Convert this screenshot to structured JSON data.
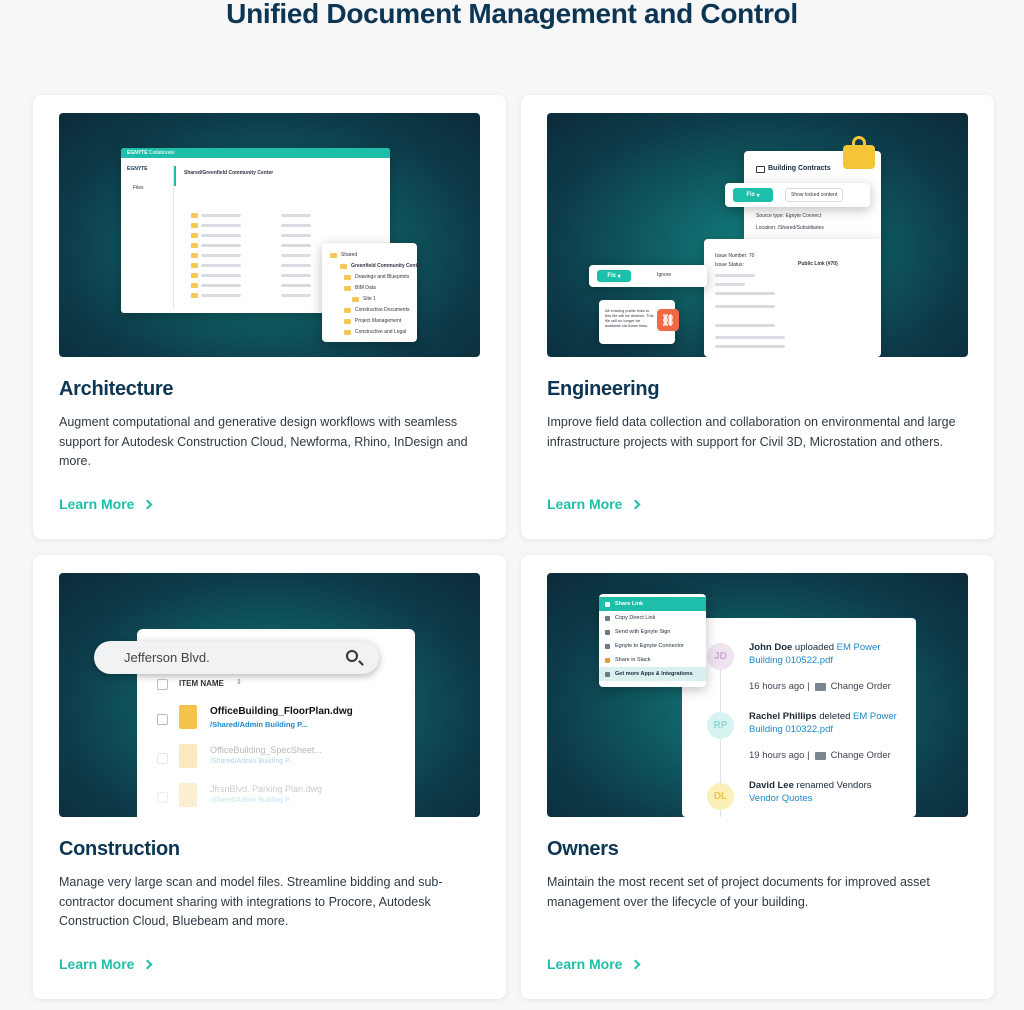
{
  "page": {
    "title": "Unified Document Management and Control"
  },
  "cards": [
    {
      "title": "Architecture",
      "description": "Augment computational and generative design workflows with seamless support for Autodesk Construction Cloud, Newforma, Rhino, InDesign and more.",
      "link": "Learn More"
    },
    {
      "title": "Engineering",
      "description": "Improve field data collection and collaboration on environmental and large infrastructure projects with support for Civil 3D, Microstation and others.",
      "link": "Learn More"
    },
    {
      "title": "Construction",
      "description": "Manage very large scan and model files. Streamline bidding and sub-contractor document sharing with integrations to Procore, Autodesk Construction Cloud, Bluebeam and more.",
      "link": "Learn More"
    },
    {
      "title": "Owners",
      "description": "Maintain the most recent set of project documents for improved asset management over the lifecycle of your building.",
      "link": "Learn More"
    }
  ],
  "arch_mock": {
    "brand": "EGNYTE",
    "app": "Collaborate",
    "path": "Shared/Greenfield Community Center",
    "sidebar_item": "Files",
    "tree": [
      "Shared",
      "Greenfield Community Center",
      "Drawings and Blueprints",
      "BIM Data",
      "Site 1",
      "Constructive Documents",
      "Project Management",
      "Constructive and Legal"
    ]
  },
  "eng_mock": {
    "panel_title": "Building Contracts",
    "fix": "Fix",
    "show_locked": "Show locked content",
    "source": "Source type: Egnyte Connect",
    "location": "Location: /Shared/Subsidiaries",
    "public_link": "Public Link (#70)",
    "ignore": "Ignore",
    "issue_number": "Issue Number: 70",
    "issue_status": "Issue Status:",
    "note": "All existing public links to this file will be deleted. This file will no longer be available via these links."
  },
  "cons_mock": {
    "search_value": "Jefferson Blvd.",
    "col_header": "ITEM NAME",
    "files": [
      {
        "name": "OfficeBuilding_FloorPlan.dwg",
        "path": "/Shared/Admin Building P..."
      },
      {
        "name": "OfficeBuilding_SpecSheet...",
        "path": "/Shared/Admin Building P..."
      },
      {
        "name": "JfrsnBlvd. Parking Plan.dwg",
        "path": "/Shared/Admin Building P..."
      }
    ]
  },
  "own_mock": {
    "menu": [
      "Share Link",
      "Copy Direct Link",
      "Send with Egnyte Sign",
      "Egnyte to Egnyte Connector",
      "Share in Slack",
      "Get more Apps & Integrations"
    ],
    "events": [
      {
        "initials": "JD",
        "actor": "John Doe",
        "action": "uploaded",
        "target": "EM Power Building 010522.pdf",
        "time": "16 hours ago |",
        "folder": "Change Order",
        "color": "#efe3f0",
        "fg": "#c8a9cf"
      },
      {
        "initials": "RP",
        "actor": "Rachel Phillips",
        "action": "deleted",
        "target": "EM Power Building 010322.pdf",
        "time": "19 hours ago |",
        "folder": "Change Order",
        "color": "#d7f3f1",
        "fg": "#8fd9d1"
      },
      {
        "initials": "DL",
        "actor": "David Lee",
        "action": "renamed Vendors",
        "target": "Vendor Quotes",
        "time": "",
        "folder": "",
        "color": "#fbf0b8",
        "fg": "#e9c849"
      }
    ]
  },
  "colors": {
    "accent": "#1ebfaa",
    "heading": "#0c3653",
    "link": "#1e88c8"
  }
}
